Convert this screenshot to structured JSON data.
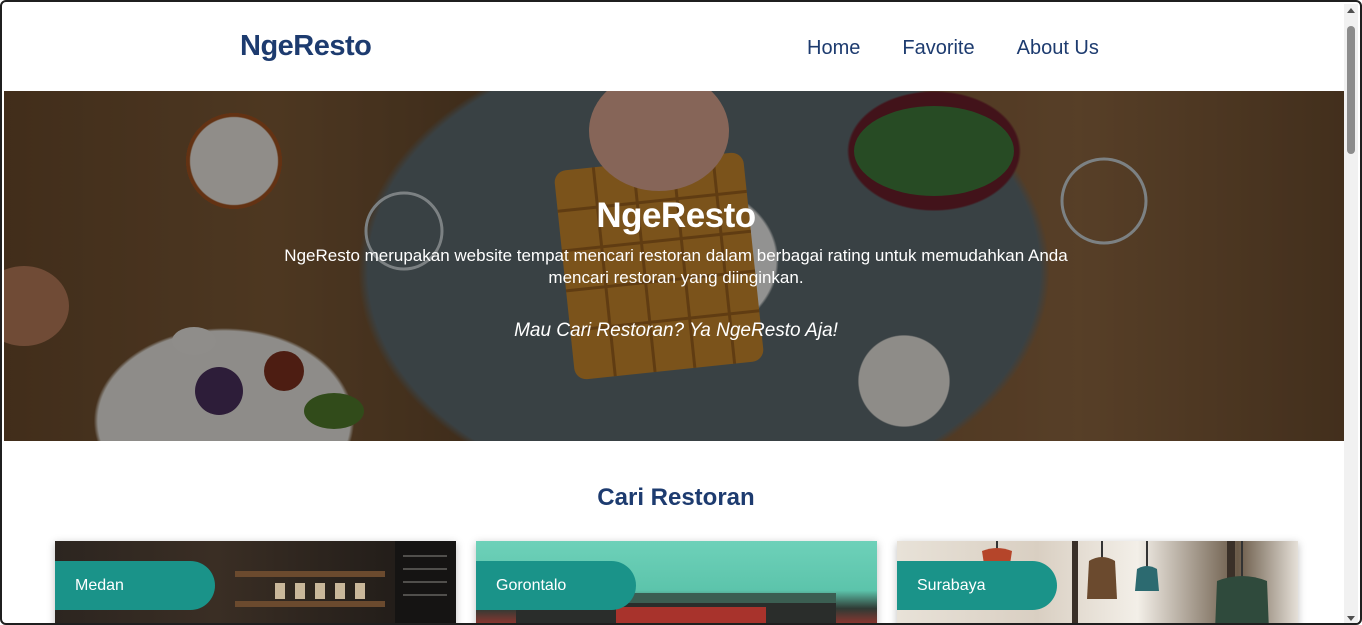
{
  "header": {
    "logo": "NgeResto",
    "nav": [
      {
        "label": "Home"
      },
      {
        "label": "Favorite"
      },
      {
        "label": "About Us"
      }
    ]
  },
  "hero": {
    "title": "NgeResto",
    "description": "NgeResto merupakan website tempat mencari restoran dalam berbagai rating untuk memudahkan Anda mencari restoran yang diinginkan.",
    "tagline": "Mau Cari Restoran? Ya NgeResto Aja!"
  },
  "section": {
    "title": "Cari Restoran"
  },
  "restaurants": [
    {
      "city": "Medan"
    },
    {
      "city": "Gorontalo"
    },
    {
      "city": "Surabaya"
    }
  ],
  "colors": {
    "brand": "#1d3b6f",
    "badge": "#1a9389"
  }
}
